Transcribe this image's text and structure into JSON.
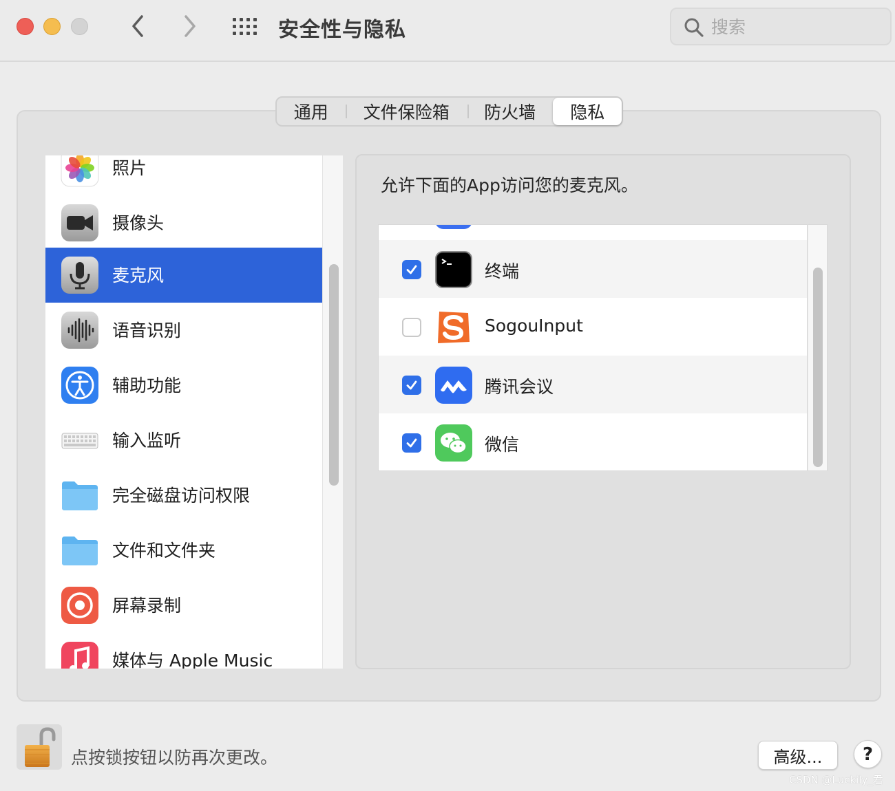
{
  "window": {
    "title": "安全性与隐私",
    "search_placeholder": "搜索"
  },
  "tabs": [
    {
      "label": "通用",
      "selected": false
    },
    {
      "label": "文件保险箱",
      "selected": false
    },
    {
      "label": "防火墙",
      "selected": false
    },
    {
      "label": "隐私",
      "selected": true
    }
  ],
  "sidebar": {
    "items": [
      {
        "label": "照片",
        "icon": "photos-icon"
      },
      {
        "label": "摄像头",
        "icon": "camera-icon"
      },
      {
        "label": "麦克风",
        "icon": "microphone-icon",
        "selected": true
      },
      {
        "label": "语音识别",
        "icon": "speech-recognition-icon"
      },
      {
        "label": "辅助功能",
        "icon": "accessibility-icon"
      },
      {
        "label": "输入监听",
        "icon": "keyboard-icon"
      },
      {
        "label": "完全磁盘访问权限",
        "icon": "folder-icon"
      },
      {
        "label": "文件和文件夹",
        "icon": "folder-icon"
      },
      {
        "label": "屏幕录制",
        "icon": "screen-recording-icon"
      },
      {
        "label": "媒体与 Apple Music",
        "icon": "music-icon"
      }
    ]
  },
  "content": {
    "heading": "允许下面的App访问您的麦克风。",
    "apps": [
      {
        "name": "终端",
        "checked": true,
        "icon": "terminal-icon"
      },
      {
        "name": "SogouInput",
        "checked": false,
        "icon": "sogou-icon"
      },
      {
        "name": "腾讯会议",
        "checked": true,
        "icon": "tencent-meeting-icon"
      },
      {
        "name": "微信",
        "checked": true,
        "icon": "wechat-icon"
      }
    ]
  },
  "footer": {
    "lock_text": "点按锁按钮以防再次更改。",
    "advanced_label": "高级...",
    "help_label": "?"
  },
  "watermark": "CSDN @Luckily_君",
  "colors": {
    "selection": "#2d63d9",
    "checkbox": "#2f6fe8"
  }
}
